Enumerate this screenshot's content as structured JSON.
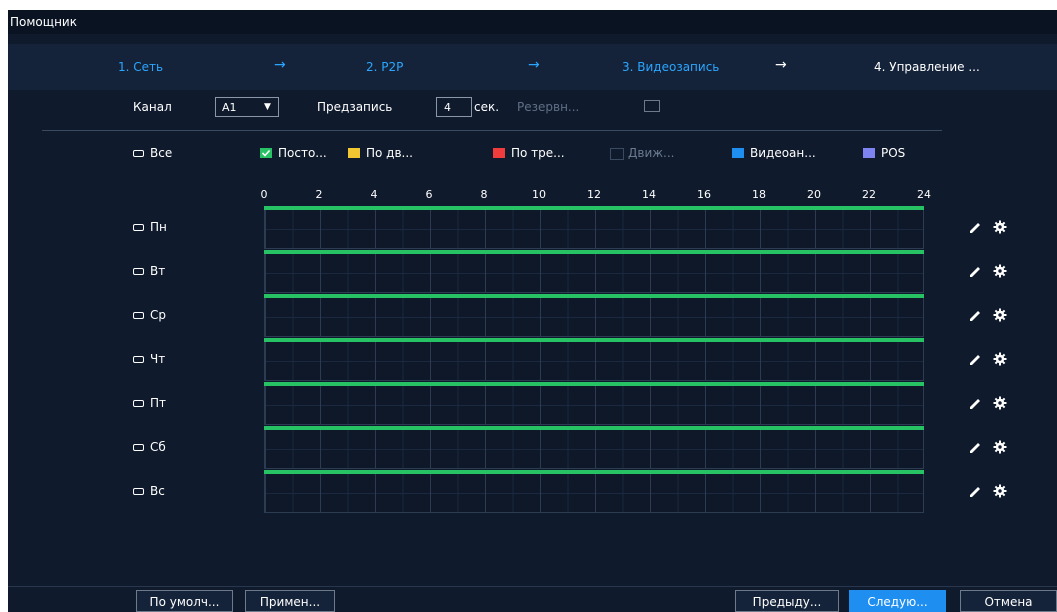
{
  "window": {
    "title": "Помощник"
  },
  "steps": [
    {
      "label": "1. Сеть"
    },
    {
      "label": "2. P2P"
    },
    {
      "label": "3. Видеозапись"
    },
    {
      "label": "4. Управление ..."
    }
  ],
  "step_arrow": "→",
  "settings": {
    "channel_label": "Канал",
    "channel_value": "A1",
    "prerecord_label": "Предзапись",
    "prerecord_value": "4",
    "prerecord_unit": "сек.",
    "backup_label": "Резервн..."
  },
  "legend": {
    "all_label": "Все",
    "items": [
      {
        "label": "Посто...",
        "color": "#26c263",
        "checked": true
      },
      {
        "label": "По дв...",
        "color": "#f2c832"
      },
      {
        "label": "По тре...",
        "color": "#f03c3c"
      },
      {
        "label": "Движ...",
        "color": "#0f1a2c",
        "disabled": true
      },
      {
        "label": "Видеоан...",
        "color": "#1e8ef0"
      },
      {
        "label": "POS",
        "color": "#7d83f0"
      }
    ]
  },
  "timeline": {
    "hours": [
      "0",
      "2",
      "4",
      "6",
      "8",
      "10",
      "12",
      "14",
      "16",
      "18",
      "20",
      "22",
      "24"
    ],
    "schedule_color": "#26c263"
  },
  "days": [
    {
      "label": "Пн",
      "record_from": 0,
      "record_to": 24
    },
    {
      "label": "Вт",
      "record_from": 0,
      "record_to": 24
    },
    {
      "label": "Ср",
      "record_from": 0,
      "record_to": 24
    },
    {
      "label": "Чт",
      "record_from": 0,
      "record_to": 24
    },
    {
      "label": "Пт",
      "record_from": 0,
      "record_to": 24
    },
    {
      "label": "Сб",
      "record_from": 0,
      "record_to": 24
    },
    {
      "label": "Вс",
      "record_from": 0,
      "record_to": 24
    }
  ],
  "icons": {
    "edit": "pencil-icon",
    "settings": "gear-icon"
  },
  "footer": {
    "default_label": "По умолч...",
    "apply_label": "Примен...",
    "prev_label": "Предыду...",
    "next_label": "Следую...",
    "cancel_label": "Отмена"
  }
}
